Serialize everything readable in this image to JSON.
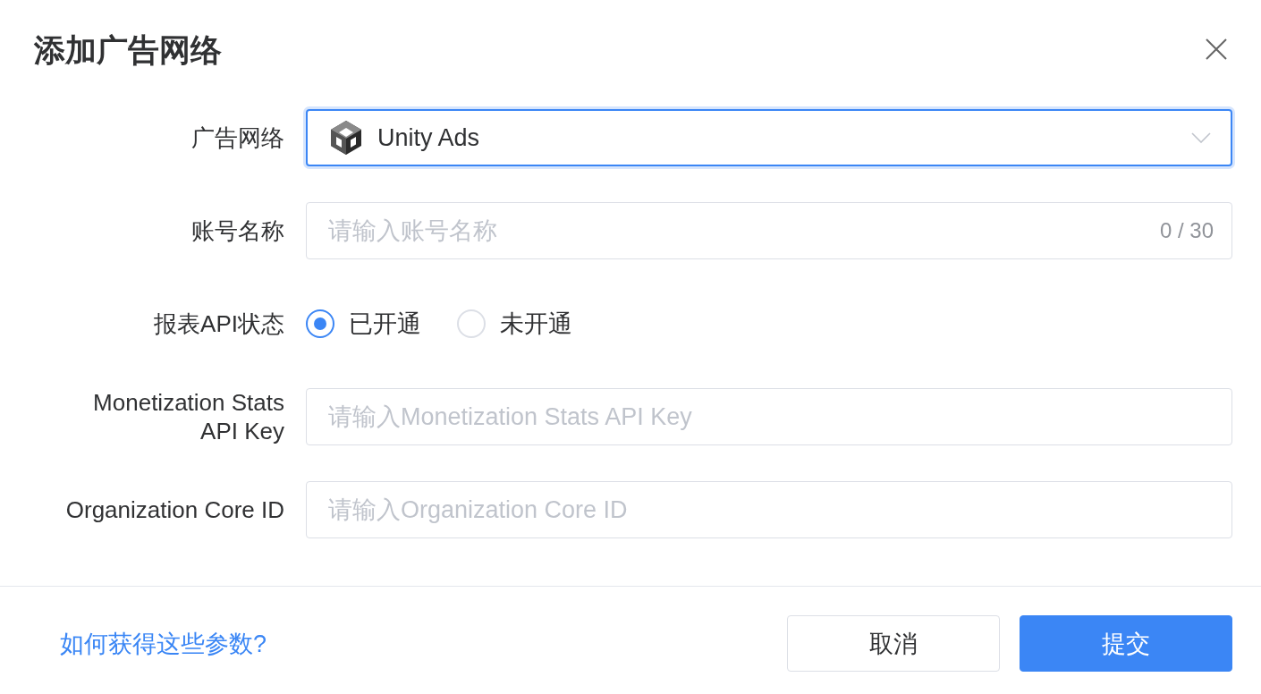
{
  "dialog": {
    "title": "添加广告网络"
  },
  "form": {
    "fields": [
      {
        "kind": "select",
        "label": "广告网络",
        "value": "Unity Ads",
        "focused": true
      },
      {
        "kind": "text",
        "label": "账号名称",
        "placeholder": "请输入账号名称",
        "counter": "0 / 30"
      },
      {
        "kind": "radio",
        "label": "报表API状态",
        "options": [
          {
            "label": "已开通",
            "selected": true
          },
          {
            "label": "未开通",
            "selected": false
          }
        ]
      },
      {
        "kind": "text",
        "label": "Monetization Stats API Key",
        "placeholder": "请输入Monetization Stats API Key"
      },
      {
        "kind": "text",
        "label": "Organization Core ID",
        "placeholder": "请输入Organization Core ID"
      }
    ]
  },
  "footer": {
    "help_link": "如何获得这些参数?",
    "buttons": [
      {
        "label": "取消",
        "kind": "secondary"
      },
      {
        "label": "提交",
        "kind": "primary"
      }
    ]
  }
}
